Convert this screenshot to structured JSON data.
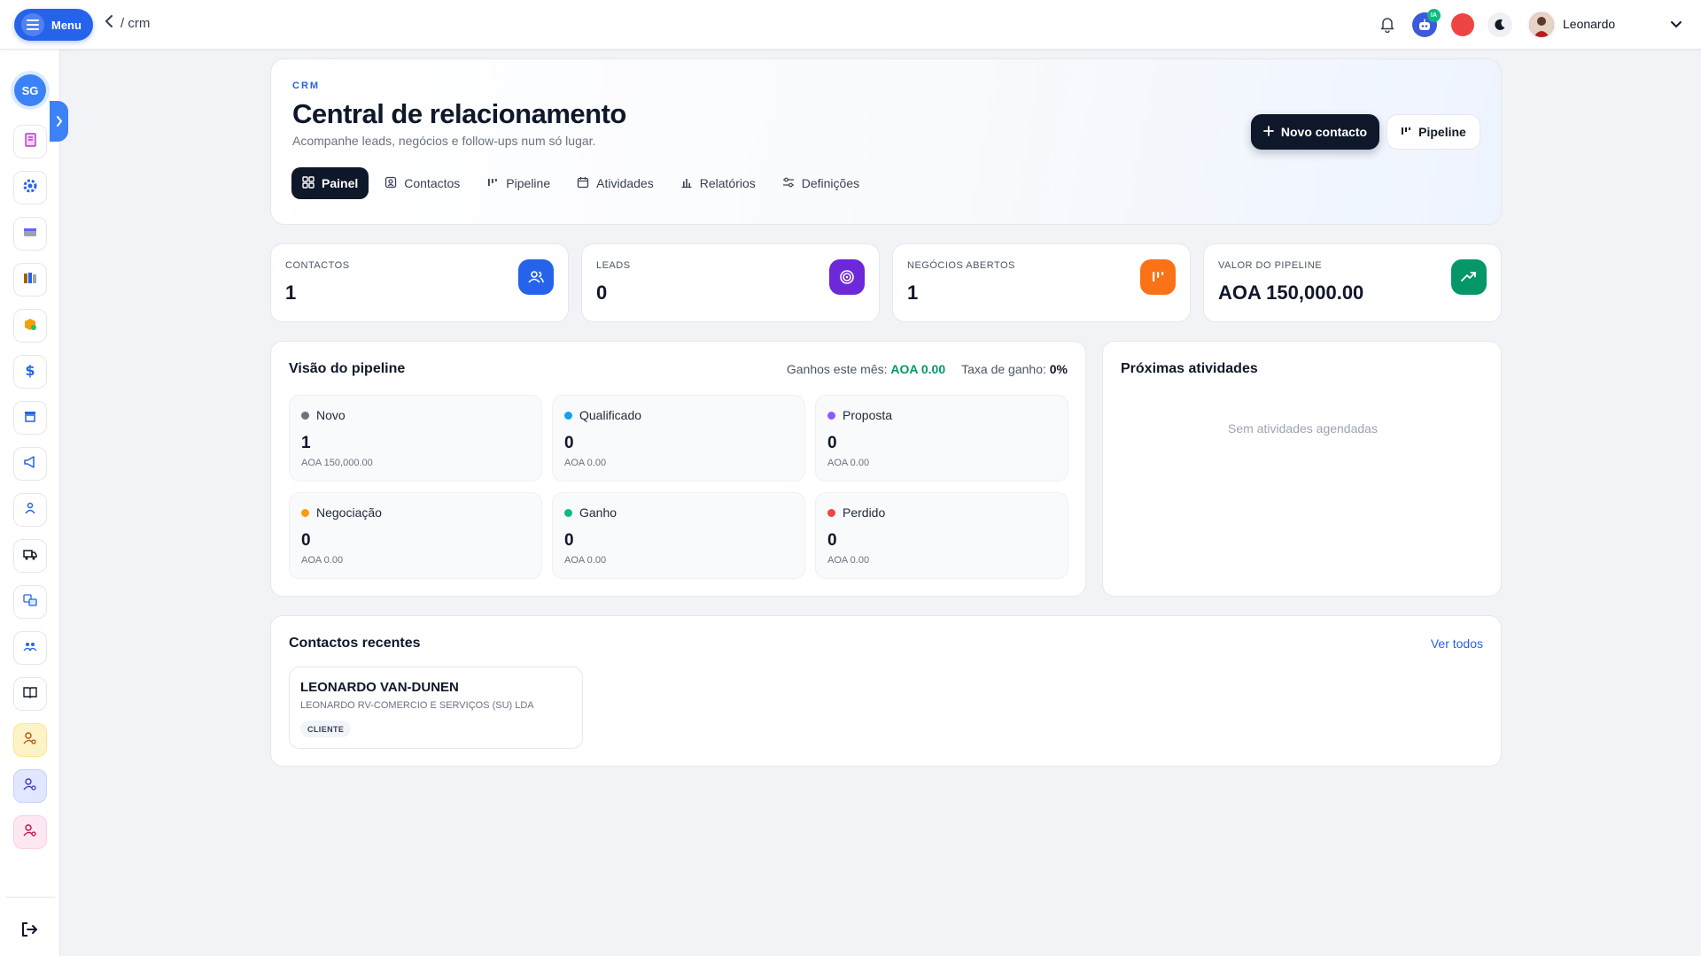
{
  "topbar": {
    "menu_label": "Menu",
    "breadcrumb": "/ crm",
    "ai_badge": "IA",
    "user_name": "Leonardo"
  },
  "sidebar": {
    "company_initials": "SG",
    "icons": [
      "receipt-icon",
      "gear-icon",
      "card-icon",
      "books-icon",
      "box-icon",
      "dollar-icon",
      "store-icon",
      "megaphone-icon",
      "team-icon",
      "truck-icon",
      "translate-icon",
      "users-icon",
      "book-icon",
      "user-yellow-icon",
      "user-blue-icon",
      "user-pink-icon"
    ]
  },
  "hero": {
    "eyebrow": "CRM",
    "title": "Central de relacionamento",
    "subtitle": "Acompanhe leads, negócios e follow-ups num só lugar.",
    "new_contact_label": "Novo contacto",
    "pipeline_label": "Pipeline",
    "tabs": [
      {
        "label": "Painel",
        "active": true
      },
      {
        "label": "Contactos",
        "active": false
      },
      {
        "label": "Pipeline",
        "active": false
      },
      {
        "label": "Atividades",
        "active": false
      },
      {
        "label": "Relatórios",
        "active": false
      },
      {
        "label": "Definições",
        "active": false
      }
    ]
  },
  "stats": [
    {
      "label": "CONTACTOS",
      "value": "1",
      "color": "#2563eb"
    },
    {
      "label": "LEADS",
      "value": "0",
      "color": "#6d28d9"
    },
    {
      "label": "NEGÓCIOS ABERTOS",
      "value": "1",
      "color": "#f97316"
    },
    {
      "label": "VALOR DO PIPELINE",
      "value": "AOA 150,000.00",
      "color": "#059669"
    }
  ],
  "pipeline": {
    "title": "Visão do pipeline",
    "won_label": "Ganhos este mês:",
    "won_value": "AOA 0.00",
    "rate_label": "Taxa de ganho:",
    "rate_value": "0%",
    "stages": [
      {
        "name": "Novo",
        "count": "1",
        "amount": "AOA 150,000.00",
        "color": "#6b7280"
      },
      {
        "name": "Qualificado",
        "count": "0",
        "amount": "AOA 0.00",
        "color": "#0ea5e9"
      },
      {
        "name": "Proposta",
        "count": "0",
        "amount": "AOA 0.00",
        "color": "#8b5cf6"
      },
      {
        "name": "Negociação",
        "count": "0",
        "amount": "AOA 0.00",
        "color": "#f59e0b"
      },
      {
        "name": "Ganho",
        "count": "0",
        "amount": "AOA 0.00",
        "color": "#10b981"
      },
      {
        "name": "Perdido",
        "count": "0",
        "amount": "AOA 0.00",
        "color": "#ef4444"
      }
    ]
  },
  "activities": {
    "title": "Próximas atividades",
    "empty": "Sem atividades agendadas"
  },
  "recent": {
    "title": "Contactos recentes",
    "see_all": "Ver todos",
    "contacts": [
      {
        "name": "LEONARDO VAN-DUNEN",
        "company": "LEONARDO RV-COMERCIO E SERVIÇOS (SU) LDA",
        "badge": "CLIENTE"
      }
    ]
  }
}
